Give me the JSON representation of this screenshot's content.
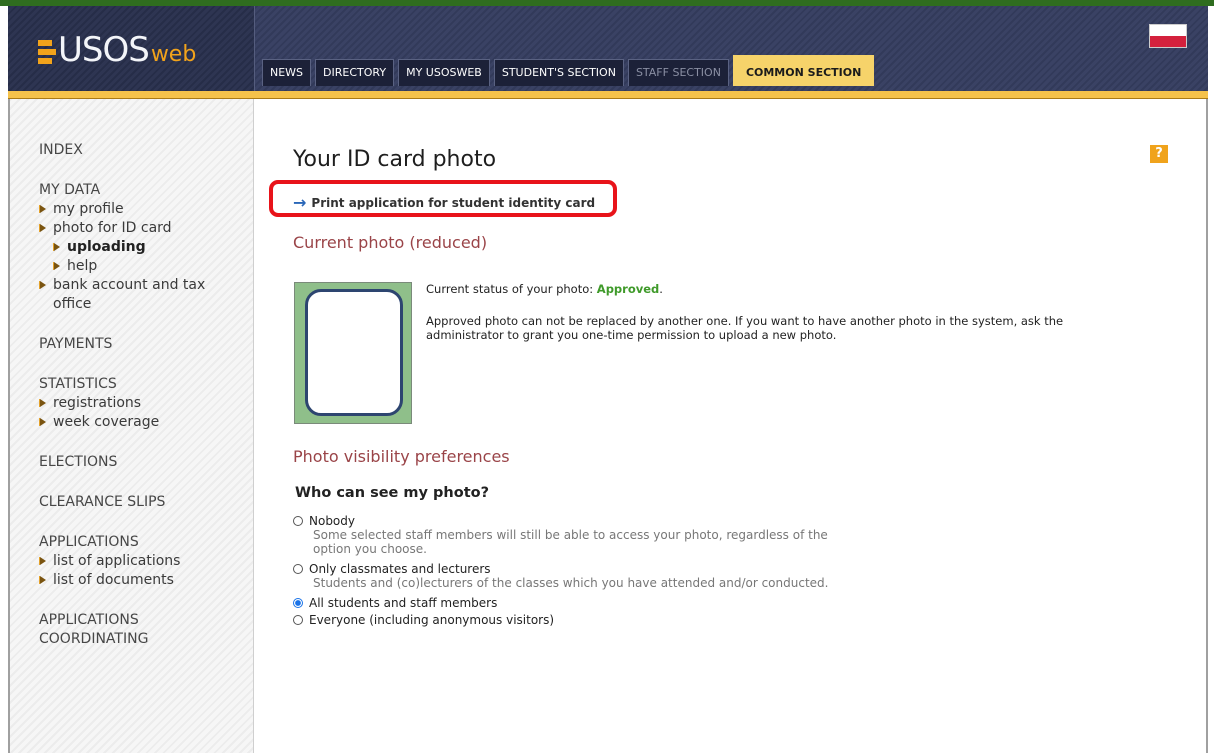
{
  "header": {
    "logo_main": "USOS",
    "logo_sub": "web",
    "tabs": [
      {
        "label": "NEWS"
      },
      {
        "label": "DIRECTORY"
      },
      {
        "label": "MY USOSWEB"
      },
      {
        "label": "STUDENT'S SECTION"
      },
      {
        "label": "STAFF SECTION"
      },
      {
        "label": "COMMON SECTION"
      }
    ]
  },
  "sidebar": {
    "index": "INDEX",
    "my_data": {
      "heading": "MY DATA",
      "items": [
        "my profile",
        "photo for ID card",
        "uploading",
        "help",
        "bank account and tax office"
      ]
    },
    "payments": "PAYMENTS",
    "statistics": {
      "heading": "STATISTICS",
      "items": [
        "registrations",
        "week coverage"
      ]
    },
    "elections": "ELECTIONS",
    "clearance": "CLEARANCE SLIPS",
    "applications": {
      "heading": "APPLICATIONS",
      "items": [
        "list of applications",
        "list of documents"
      ]
    },
    "coordinating": "APPLICATIONS COORDINATING"
  },
  "main": {
    "help_icon": "?",
    "title": "Your ID card photo",
    "print_link": "Print application for student identity card",
    "current_photo_title": "Current photo (reduced)",
    "status_prefix": "Current status of your photo: ",
    "status_value": "Approved",
    "status_suffix": ".",
    "description": "Approved photo can not be replaced by another one. If you want to have another photo in the system, ask the administrator to grant you one-time permission to upload a new photo.",
    "visibility_title": "Photo visibility preferences",
    "who_title": "Who can see my photo?",
    "options": [
      {
        "label": "Nobody",
        "desc": "Some selected staff members will still be able to access your photo, regardless of the option you choose."
      },
      {
        "label": "Only classmates and lecturers",
        "desc": "Students and (co)lecturers of the classes which you have attended and/or conducted."
      },
      {
        "label": "All students and staff members",
        "desc": ""
      },
      {
        "label": "Everyone (including anonymous visitors)",
        "desc": ""
      }
    ],
    "selected_option": "All students and staff members"
  },
  "colors": {
    "accent_orange": "#f5c24b",
    "header_navy": "#323a5a",
    "section_title": "#9a4448",
    "approved_green": "#3f9a2a",
    "highlight_red": "#e8131a"
  },
  "icons": {
    "arrow": "→",
    "bullet": "triangle-bullet-icon"
  }
}
